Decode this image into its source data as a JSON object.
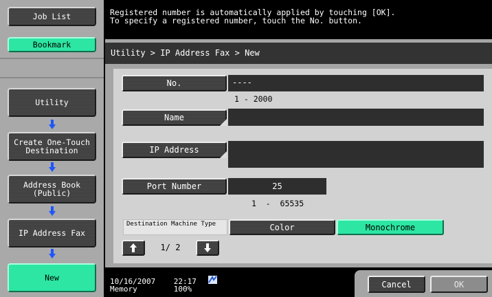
{
  "sidebar": {
    "job_list": "Job List",
    "bookmark": "Bookmark",
    "utility": "Utility",
    "create_one_touch": "Create One-Touch Destination",
    "address_book": "Address Book (Public)",
    "ip_address_fax": "IP Address Fax",
    "new": "New"
  },
  "message": "Registered number is automatically applied by touching [OK].\nTo specify a registered number, touch the No. button.",
  "breadcrumb": "Utility > IP Address Fax > New",
  "form": {
    "no_label": "No.",
    "no_value": "----",
    "no_range": "1 - 2000",
    "name_label": "Name",
    "name_value": "",
    "ip_label": "IP Address",
    "ip_value": "",
    "port_label": "Port Number",
    "port_value": "25",
    "port_range": "1  -  65535",
    "dest_type_label": "Destination Machine Type",
    "color_option": "Color",
    "mono_option": "Monochrome",
    "page_indicator": "1/ 2"
  },
  "status": {
    "datetime": "10/16/2007    22:17",
    "memory": "Memory        100%"
  },
  "footer": {
    "cancel": "Cancel",
    "ok": "OK"
  },
  "colors": {
    "accent_green": "#2de6a3",
    "arrow_blue": "#1e56ff"
  },
  "icons": {
    "page_up": "up-arrow-icon",
    "page_down": "down-arrow-icon",
    "status": "network-status-icon"
  }
}
